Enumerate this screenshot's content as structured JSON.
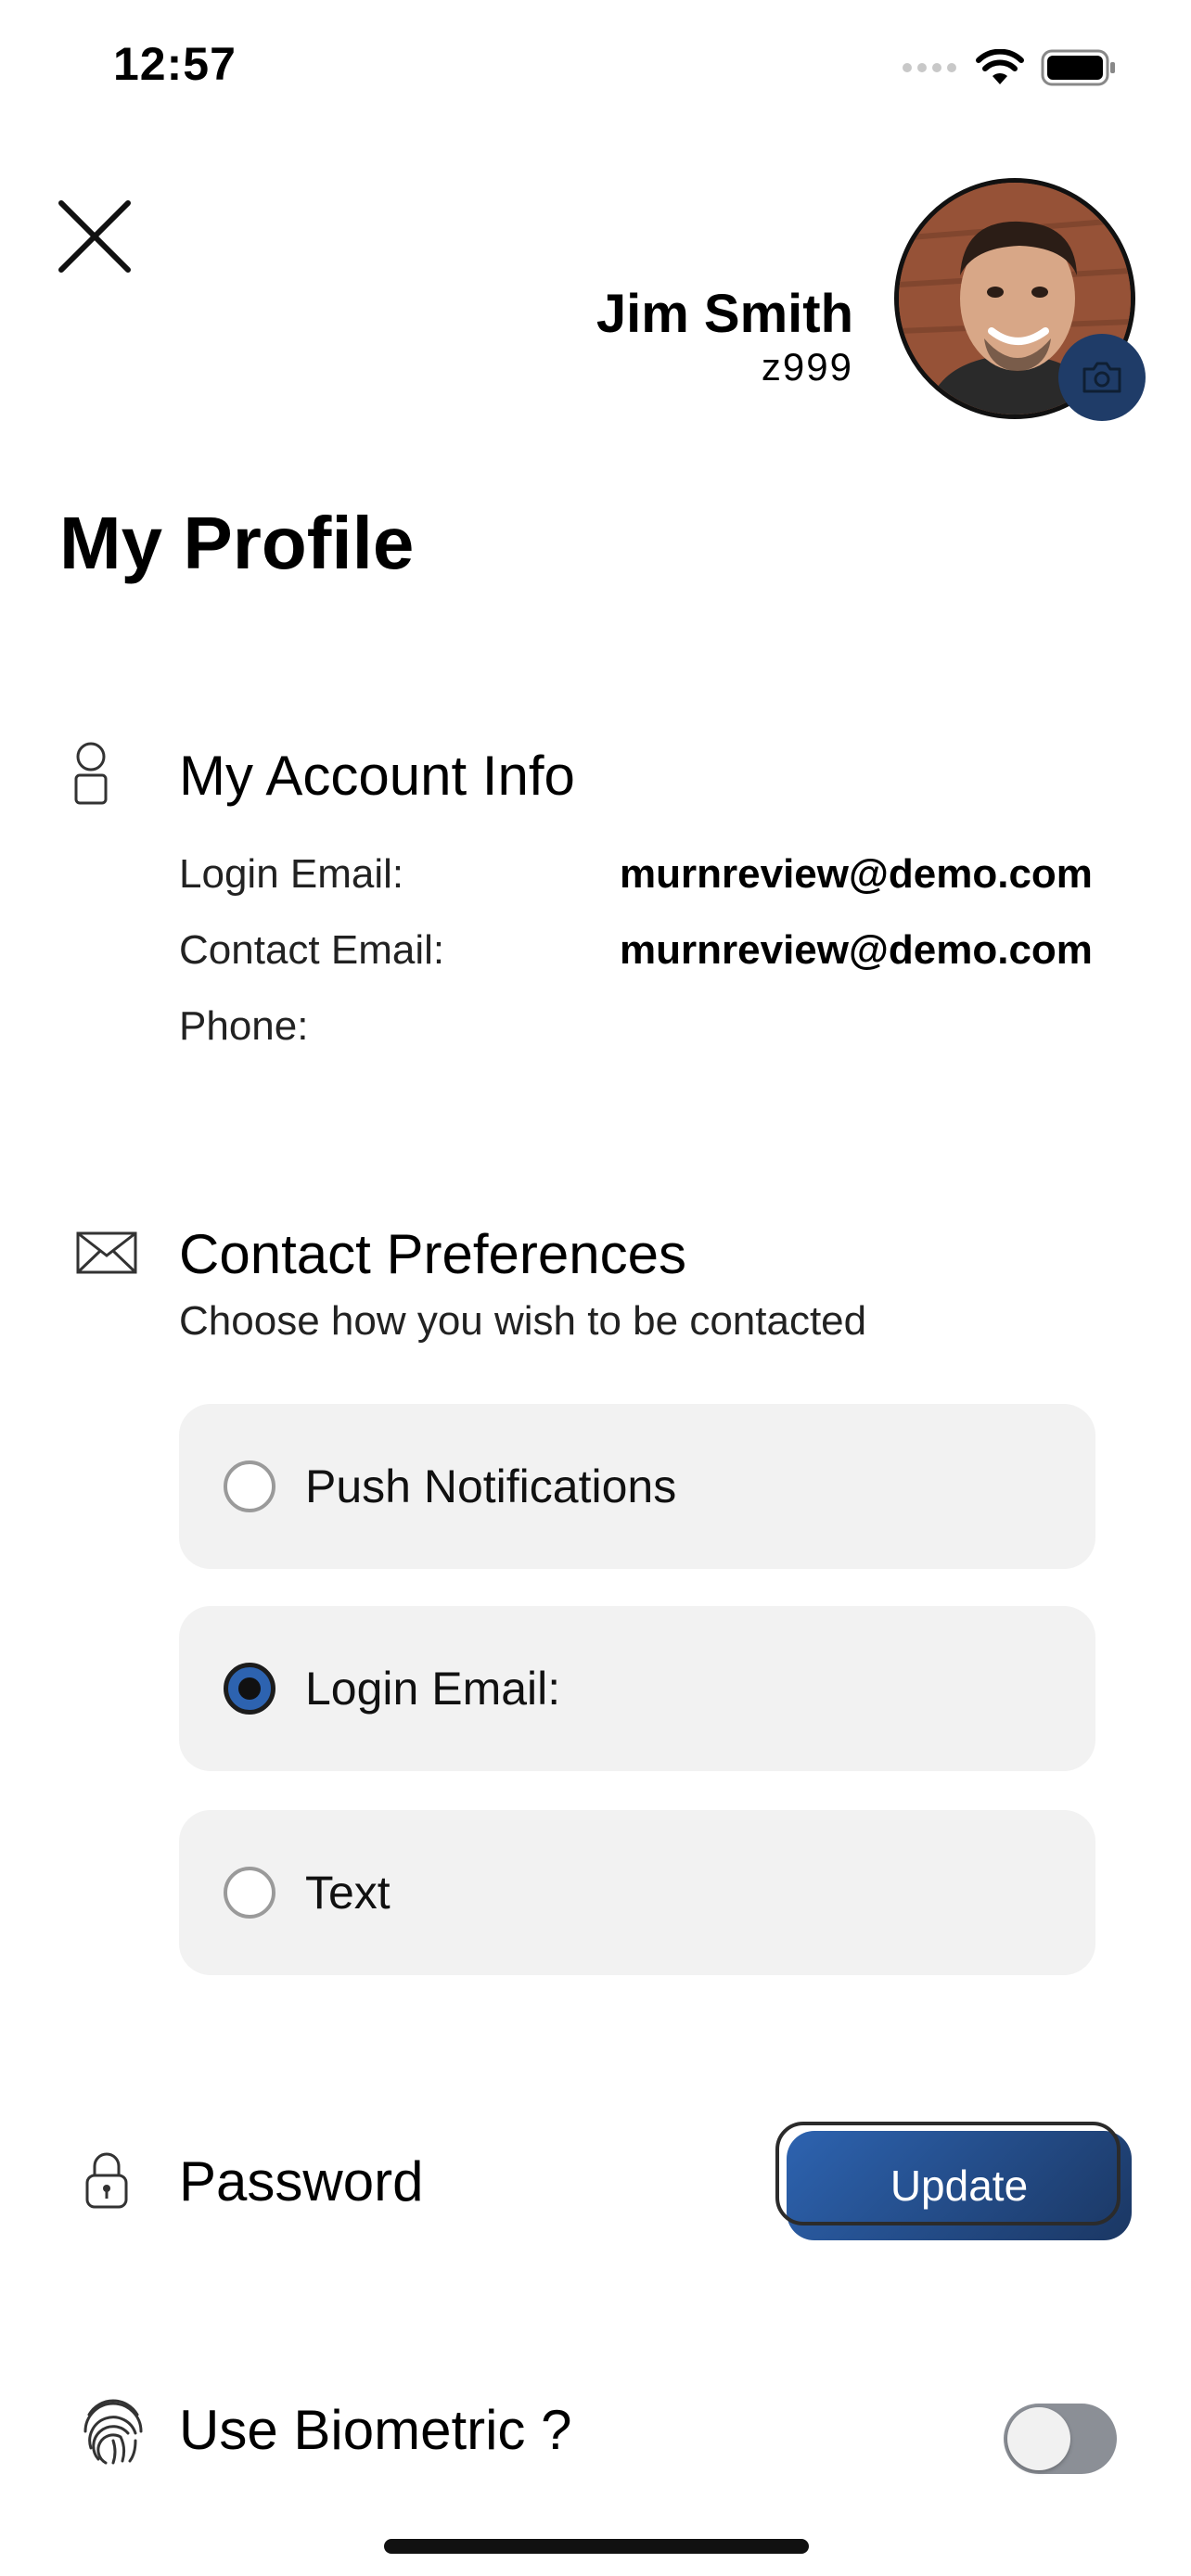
{
  "status_bar": {
    "time": "12:57"
  },
  "header": {
    "user_name": "Jim Smith",
    "user_id": "z999"
  },
  "page_title": "My Profile",
  "account_info": {
    "heading": "My Account Info",
    "rows": [
      {
        "label": "Login Email:",
        "value": "murnreview@demo.com"
      },
      {
        "label": "Contact Email:",
        "value": "murnreview@demo.com"
      },
      {
        "label": "Phone:",
        "value": ""
      }
    ]
  },
  "contact_preferences": {
    "heading": "Contact Preferences",
    "subheading": "Choose how you wish to be contacted",
    "options": [
      {
        "label": "Push Notifications",
        "selected": false
      },
      {
        "label": "Login Email:",
        "selected": true
      },
      {
        "label": "Text",
        "selected": false
      }
    ]
  },
  "password": {
    "label": "Password",
    "button_label": "Update"
  },
  "biometric": {
    "label": "Use Biometric ?",
    "enabled": false
  },
  "colors": {
    "accent": "#2d63b0",
    "accent_dark": "#1b3763",
    "option_bg": "#f2f2f2",
    "toggle_off": "#8b8f96"
  }
}
